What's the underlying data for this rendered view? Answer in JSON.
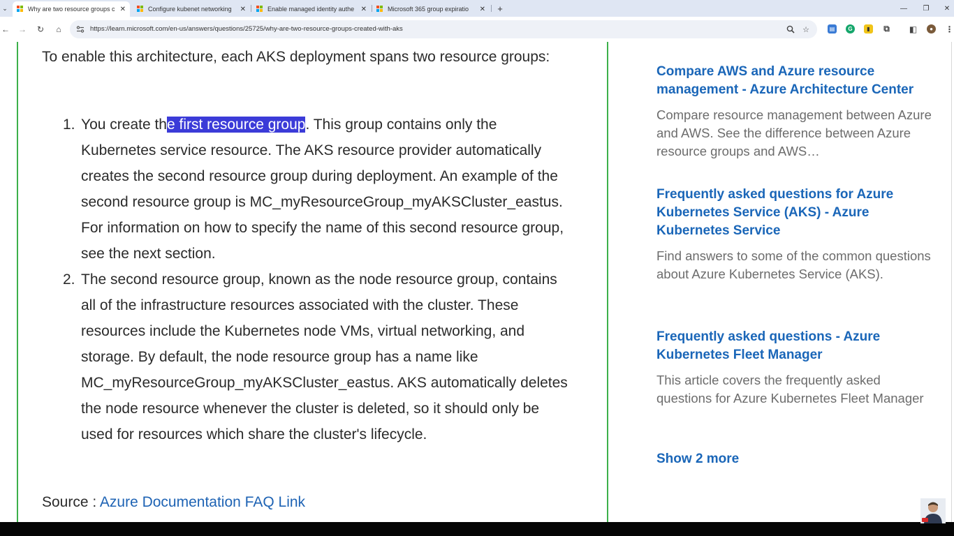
{
  "browser": {
    "tabs": [
      {
        "title": "Why are two resource groups c",
        "active": true,
        "close": "✕"
      },
      {
        "title": "Configure kubenet networking",
        "active": false,
        "close": "✕"
      },
      {
        "title": "Enable managed identity authe",
        "active": false,
        "close": "✕"
      },
      {
        "title": "Microsoft 365 group expiratio",
        "active": false,
        "close": "✕"
      }
    ],
    "new_tab": "+",
    "tab_menu": "⌄",
    "window_controls": {
      "minimize": "—",
      "restore": "❐",
      "close": "✕"
    },
    "nav": {
      "back": "←",
      "forward": "→",
      "reload": "↻",
      "home": "⌂"
    },
    "url": "https://learn.microsoft.com/en-us/answers/questions/25725/why-are-two-resource-groups-created-with-aks",
    "icons": [
      "site-settings-icon",
      "zoom-icon",
      "bookmark-star-icon",
      "extension-icon",
      "grammarly-icon",
      "notes-extension-icon",
      "puzzle-icon",
      "sidepanel-icon",
      "profile-avatar-icon",
      "menu-kebab-icon"
    ]
  },
  "article": {
    "intro": "To enable this architecture, each AKS deployment spans two resource groups:",
    "steps": [
      {
        "number": "1.",
        "before": "You create th",
        "highlight": "e first resource group",
        "after": ". This group contains only the Kubernetes service resource. The AKS resource provider automatically creates the second resource group during deployment. An example of the second resource group is MC_myResourceGroup_myAKSCluster_eastus. For information on how to specify the name of this second resource group, see the next section."
      },
      {
        "number": "2.",
        "text": "The second resource group, known as the node resource group, contains all of the infrastructure resources associated with the cluster. These resources include the Kubernetes node VMs, virtual networking, and storage. By default, the node resource group has a name like MC_myResourceGroup_myAKSCluster_eastus. AKS automatically deletes the node resource whenever the cluster is deleted, so it should only be used for resources which share the cluster's lifecycle."
      }
    ],
    "source_label": "Source : ",
    "source_link": "Azure Documentation FAQ Link"
  },
  "related": {
    "items": [
      {
        "title": "Compare AWS and Azure resource management - Azure Architecture Center",
        "description": "Compare resource management between Azure and AWS. See the difference between Azure resource groups and AWS…"
      },
      {
        "title": "Frequently asked questions for Azure Kubernetes Service (AKS) - Azure Kubernetes Service",
        "description": "Find answers to some of the common questions about Azure Kubernetes Service (AKS)."
      },
      {
        "title": "Frequently asked questions - Azure Kubernetes Fleet Manager",
        "description": "This article covers the frequently asked questions for Azure Kubernetes Fleet Manager"
      }
    ],
    "show_more": "Show 2 more"
  },
  "colors": {
    "accent_link": "#1a66b8",
    "highlight": "#3b3bd8",
    "border_green": "#3cb04a"
  }
}
